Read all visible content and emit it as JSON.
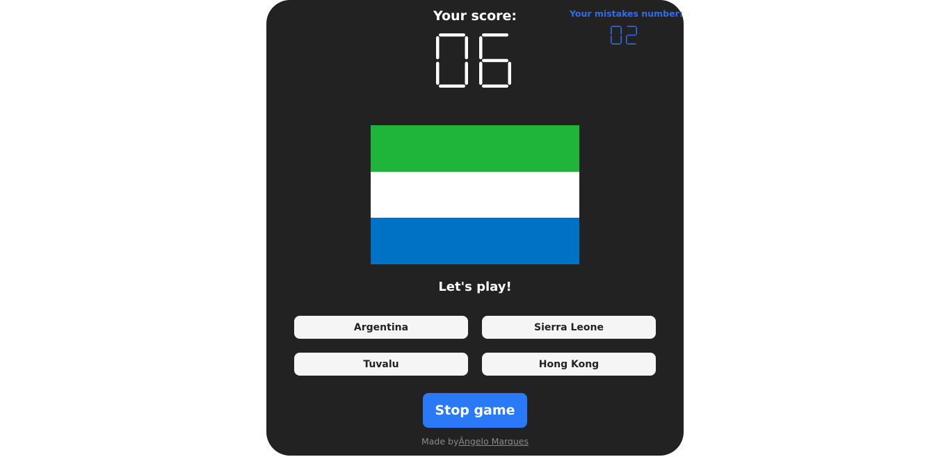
{
  "score": {
    "label": "Your score:",
    "value": "06",
    "color": "#ffffff"
  },
  "mistakes": {
    "label": "Your mistakes number:",
    "value": "02",
    "color": "#2c6ef2"
  },
  "flag": {
    "country": "Sierra Leone",
    "stripes": [
      "#1eb53a",
      "#ffffff",
      "#0072c6"
    ]
  },
  "prompt": "Let's play!",
  "options": [
    "Argentina",
    "Sierra Leone",
    "Tuvalu",
    "Hong Kong"
  ],
  "stop_button": {
    "label": "Stop game",
    "color": "#2a7af7"
  },
  "footer": {
    "prefix": "Made by",
    "author": "Ângelo Marques"
  }
}
